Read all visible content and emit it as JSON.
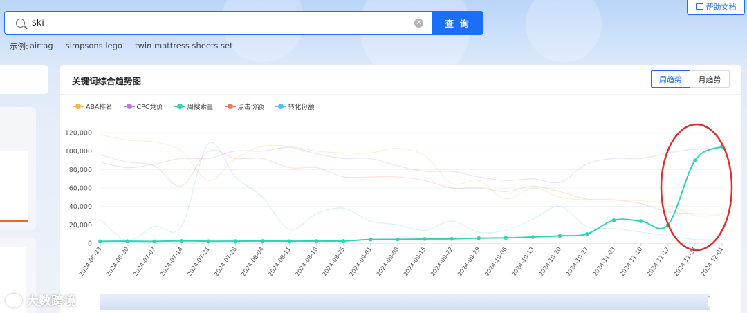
{
  "search": {
    "value": "ski",
    "button_label": "查 询",
    "clear_symbol": "✕"
  },
  "examples": {
    "label": "示例:",
    "items": [
      "airtag",
      "simpsons lego",
      "twin mattress sheets set"
    ]
  },
  "help": {
    "label": "帮助文档"
  },
  "card": {
    "title": "关键词综合趋势图",
    "toggle_week": "周趋势",
    "toggle_month": "月趋势",
    "active_toggle": "周趋势"
  },
  "watermark": {
    "text": "大数跨境"
  },
  "colors": {
    "accent": "#1a6ff5",
    "aba": "#f5b942",
    "cpc": "#b57be8",
    "weekly": "#33d1b4",
    "click": "#f37a5e",
    "conversion": "#52c3ee",
    "annotation": "#e02d2d"
  },
  "chart_data": {
    "type": "line",
    "title": "关键词综合趋势图",
    "legend": [
      "ABA排名",
      "CPC竞价",
      "周搜索量",
      "点击份额",
      "转化份额"
    ],
    "legend_position": "top-left",
    "grid": true,
    "ylim": [
      0,
      120000
    ],
    "y_ticks": [
      "0",
      "20,000",
      "40,000",
      "60,000",
      "80,000",
      "100,000",
      "120,000"
    ],
    "categories": [
      "2024-06-23",
      "2024-06-30",
      "2024-07-07",
      "2024-07-14",
      "2024-07-21",
      "2024-07-28",
      "2024-08-04",
      "2024-08-11",
      "2024-08-18",
      "2024-08-25",
      "2024-09-01",
      "2024-09-08",
      "2024-09-15",
      "2024-09-22",
      "2024-09-29",
      "2024-10-06",
      "2024-10-13",
      "2024-10-20",
      "2024-10-27",
      "2024-11-03",
      "2024-11-10",
      "2024-11-17",
      "2024-11-24",
      "2024-12-01"
    ],
    "series": [
      {
        "name": "周搜索量",
        "color": "#33d1b4",
        "primary": true,
        "values": [
          2000,
          2200,
          2000,
          2500,
          2100,
          2200,
          2300,
          2200,
          2300,
          2400,
          4000,
          4100,
          4600,
          4700,
          5500,
          5800,
          6800,
          8000,
          10000,
          25000,
          24000,
          20000,
          90000,
          105000
        ]
      },
      {
        "name": "ABA排名",
        "color": "#f5b942",
        "primary": false,
        "values": [
          118000,
          112000,
          110000,
          100000,
          68000,
          92000,
          105000,
          105000,
          100000,
          98000,
          98000,
          103000,
          95000,
          65000,
          68000,
          48000,
          60000,
          50000,
          47000,
          47000,
          46000,
          42000,
          30000,
          31000
        ]
      },
      {
        "name": "CPC竞价",
        "color": "#b57be8",
        "primary": false,
        "values": [
          88000,
          82000,
          86000,
          92000,
          92000,
          100000,
          100000,
          104000,
          97000,
          92000,
          92000,
          84000,
          78000,
          78000,
          72000,
          68000,
          70000,
          66000,
          86000,
          92000,
          92000,
          98000,
          102000,
          103000
        ]
      },
      {
        "name": "点击份额",
        "color": "#f37a5e",
        "primary": false,
        "values": [
          96000,
          88000,
          84000,
          62000,
          100000,
          92000,
          92000,
          82000,
          82000,
          72000,
          72000,
          72000,
          68000,
          60000,
          60000,
          56000,
          62000,
          56000,
          48000,
          47000,
          43000,
          34000,
          32000,
          32000
        ]
      },
      {
        "name": "转化份额",
        "color": "#52c3ee",
        "primary": false,
        "values": [
          26000,
          3000,
          18000,
          18000,
          108000,
          72000,
          50000,
          15000,
          32000,
          38000,
          24000,
          20000,
          14000,
          24000,
          12000,
          14000,
          26000,
          40000,
          18000,
          16000,
          12000,
          8000,
          4000,
          4000
        ]
      }
    ]
  }
}
